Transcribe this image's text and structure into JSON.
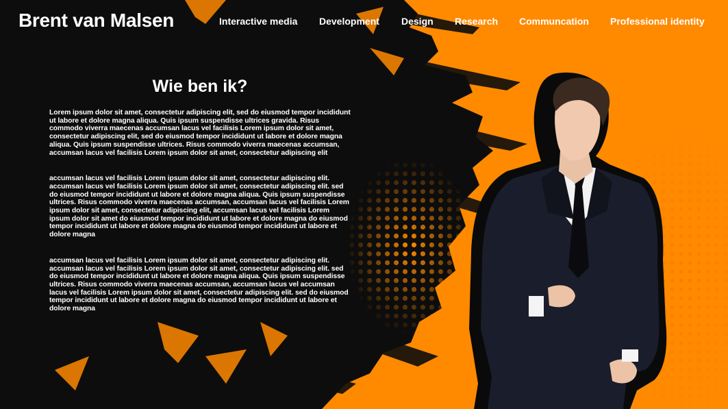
{
  "site": {
    "title": "Brent van Malsen"
  },
  "nav": {
    "items": [
      {
        "label": "Interactive media"
      },
      {
        "label": "Development"
      },
      {
        "label": "Design"
      },
      {
        "label": "Research"
      },
      {
        "label": "Communcation"
      },
      {
        "label": "Professional identity"
      }
    ]
  },
  "about": {
    "heading": "Wie ben ik?",
    "paragraphs": [
      "Lorem ipsum dolor sit amet, consectetur adipiscing elit, sed do eiusmod tempor incididunt ut labore et dolore magna aliqua. Quis ipsum suspendisse ultrices gravida. Risus commodo viverra maecenas accumsan lacus vel facilisis Lorem ipsum dolor sit amet, consectetur adipiscing elit, sed do eiusmod tempor incididunt ut labore et dolore magna aliqua. Quis ipsum suspendisse ultrices. Risus commodo viverra maecenas accumsan, accumsan lacus vel facilisis Lorem ipsum dolor sit amet, consectetur adipiscing elit",
      "accumsan lacus vel facilisis Lorem ipsum dolor sit amet, consectetur adipiscing elit. accumsan lacus vel facilisis Lorem ipsum dolor sit amet, consectetur adipiscing elit. sed do eiusmod tempor incididunt ut labore et dolore magna aliqua. Quis ipsum suspendisse ultrices. Risus commodo viverra maecenas accumsan, accumsan lacus vel facilisis Lorem ipsum dolor sit amet, consectetur adipiscing elit, accumsan lacus vel facilisis Lorem ipsum dolor sit amet do eiusmod tempor incididunt ut labore et dolore magna do eiusmod tempor incididunt ut labore et dolore magna do eiusmod tempor incididunt ut labore et dolore magna",
      "accumsan lacus vel facilisis Lorem ipsum dolor sit amet, consectetur adipiscing elit. accumsan lacus vel facilisis Lorem ipsum dolor sit amet, consectetur adipiscing elit. sed do eiusmod tempor incididunt ut labore et dolore magna aliqua. Quis ipsum suspendisse ultrices. Risus commodo viverra maecenas accumsan, accumsan lacus vel accumsan lacus vel facilisis Lorem ipsum dolor sit amet, consectetur adipiscing elit. sed do eiusmod tempor incididunt ut labore et dolore magna do eiusmod tempor incididunt ut labore et dolore magna"
    ]
  },
  "theme": {
    "accent": "#ff8a00",
    "dark": "#0d0d0d",
    "text": "#ffffff"
  }
}
